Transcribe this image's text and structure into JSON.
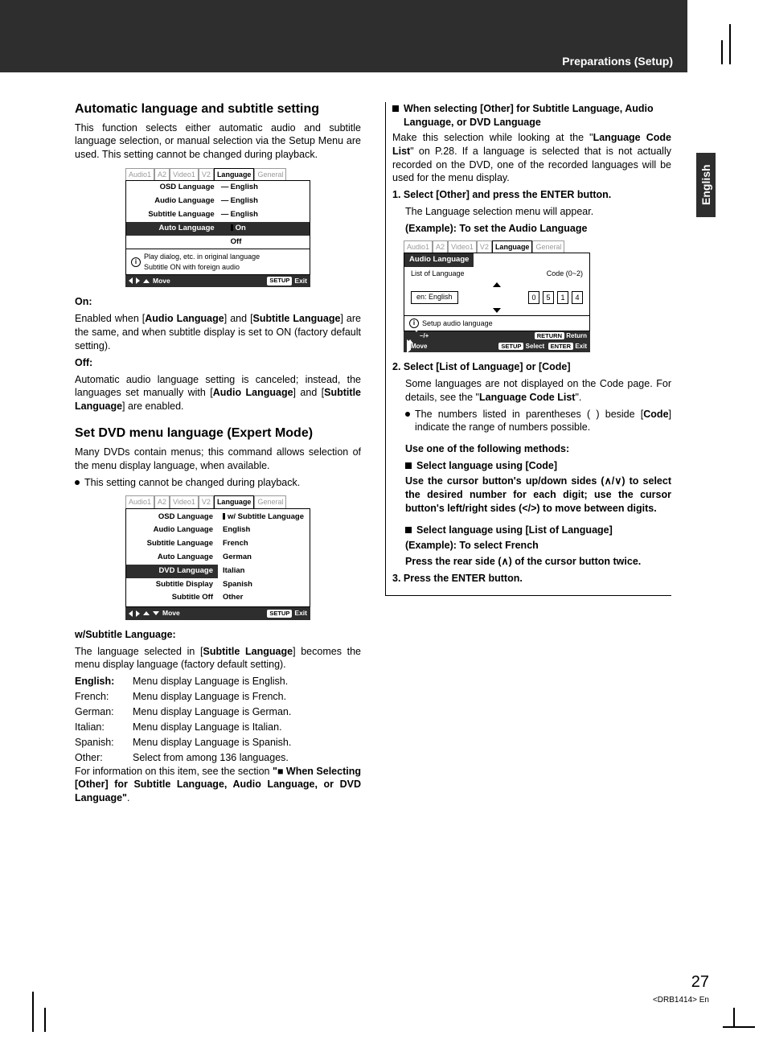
{
  "header": {
    "section": "Preparations (Setup)",
    "langTab": "English"
  },
  "page": {
    "number": "27",
    "docid": "<DRB1414> En"
  },
  "osdTabs": [
    "Audio1",
    "A2",
    "Video1",
    "V2",
    "Language",
    "General"
  ],
  "left": {
    "h1": "Automatic language and subtitle setting",
    "intro": "This function selects either automatic audio and subtitle language selection, or manual selection via the Setup Menu are used. This setting cannot be changed during playback.",
    "osd1": {
      "rows": [
        {
          "l": "OSD Language",
          "sep": "—",
          "r": "English"
        },
        {
          "l": "Audio Language",
          "sep": "—",
          "r": "English"
        },
        {
          "l": "Subtitle Language",
          "sep": "—",
          "r": "English"
        },
        {
          "l": "Auto Language",
          "sep": "",
          "r": "On",
          "sel": true,
          "marker": true
        },
        {
          "l": "",
          "sep": "",
          "r": "Off"
        }
      ],
      "info1": "Play dialog, etc. in original language",
      "info2": "Subtitle ON with foreign audio",
      "footMove": "Move",
      "footSetup": "SETUP",
      "footExit": "Exit"
    },
    "onLabel": "On:",
    "onText1": "Enabled when [",
    "onB1": "Audio Language",
    "onText2": "] and [",
    "onB2": "Subtitle Language",
    "onText3": "] are the same, and when subtitle display is set to ON (factory default setting).",
    "offLabel": "Off:",
    "offText1": "Automatic audio language setting is canceled; instead, the languages set manually with [",
    "offB1": "Audio Language",
    "offText2": "] and [",
    "offB2": "Subtitle Language",
    "offText3": "] are enabled.",
    "h2": "Set DVD menu language (Expert Mode)",
    "p2": "Many DVDs contain menus; this command allows selection of the menu display language, when available.",
    "bullet2": "This setting cannot be changed during playback.",
    "osd2": {
      "rows": [
        {
          "l": "OSD Language",
          "r": "w/ Subtitle Language",
          "marker": true
        },
        {
          "l": "Audio Language",
          "r": "English"
        },
        {
          "l": "Subtitle Language",
          "r": "French"
        },
        {
          "l": "Auto Language",
          "r": "German"
        },
        {
          "l": "DVD Language",
          "r": "Italian",
          "sel": true
        },
        {
          "l": "Subtitle Display",
          "r": "Spanish"
        },
        {
          "l": "Subtitle Off",
          "r": "Other"
        }
      ],
      "footMove": "Move",
      "footSetup": "SETUP",
      "footExit": "Exit"
    },
    "wsub": "w/Subtitle Language:",
    "wsubText1": "The language selected in [",
    "wsubB": "Subtitle Language",
    "wsubText2": "] becomes the menu display language (factory default setting).",
    "defs": [
      {
        "k": "English:",
        "v": "Menu display Language is English."
      },
      {
        "k": "French:",
        "v": "Menu display Language is French."
      },
      {
        "k": "German:",
        "v": "Menu display Language is German."
      },
      {
        "k": "Italian:",
        "v": "Menu display Language is Italian."
      },
      {
        "k": "Spanish:",
        "v": "Menu display Language is Spanish."
      },
      {
        "k": "Other:",
        "v": "Select from among 136 languages."
      }
    ],
    "tail1": "For information on this item, see the section ",
    "tailB": "\"■ When Selecting [Other] for Subtitle Language, Audio Language, or DVD Language\"",
    "tail2": "."
  },
  "right": {
    "h1": "When selecting [Other] for Subtitle Language, Audio Language, or DVD Language",
    "p1a": "Make this selection while looking at the \"",
    "p1b": "Language Code List",
    "p1c": "\" on P.28. If a language is selected that is not actually recorded on the DVD, one of the recorded languages will be used for the menu display.",
    "step1": "1. Select [Other] and press the ENTER button.",
    "step1sub": "The Language selection menu will appear.",
    "step1ex": "(Example): To set the Audio Language",
    "osd3": {
      "hdr": "Audio Language",
      "listLabel": "List of Language",
      "codeLabel": "Code (0~2)",
      "lang": "en: English",
      "digits": [
        "0",
        "5",
        "1",
        "4"
      ],
      "info": "Setup audio language",
      "f_updown": "–/+",
      "f_return": "RETURN",
      "f_returnT": "Return",
      "f_move": "Move",
      "f_setup": "SETUP",
      "f_select": "Select",
      "f_enter": "ENTER",
      "f_exit": "Exit"
    },
    "step2": "2. Select [List of Language] or [Code]",
    "step2a": "Some languages are not displayed on the Code page. For details, see the \"",
    "step2b": "Language Code List",
    "step2c": "\".",
    "step2bullet1": "The numbers listed in parentheses ( ) beside [",
    "step2bullet1b": "Code",
    "step2bullet1c": "] indicate the range of numbers possible.",
    "useOne": "Use one of the following methods:",
    "codeHdr": "Select language using [Code]",
    "codeBody": "Use the cursor button's up/down sides (∧/∨) to select the desired number for each digit; use the cursor button's left/right sides (</>) to move between digits.",
    "listHdr": "Select language using [List of Language]",
    "listEx": "(Example): To select French",
    "listBody": "Press the rear side (∧) of the cursor button twice.",
    "step3": "3. Press the ENTER button."
  }
}
